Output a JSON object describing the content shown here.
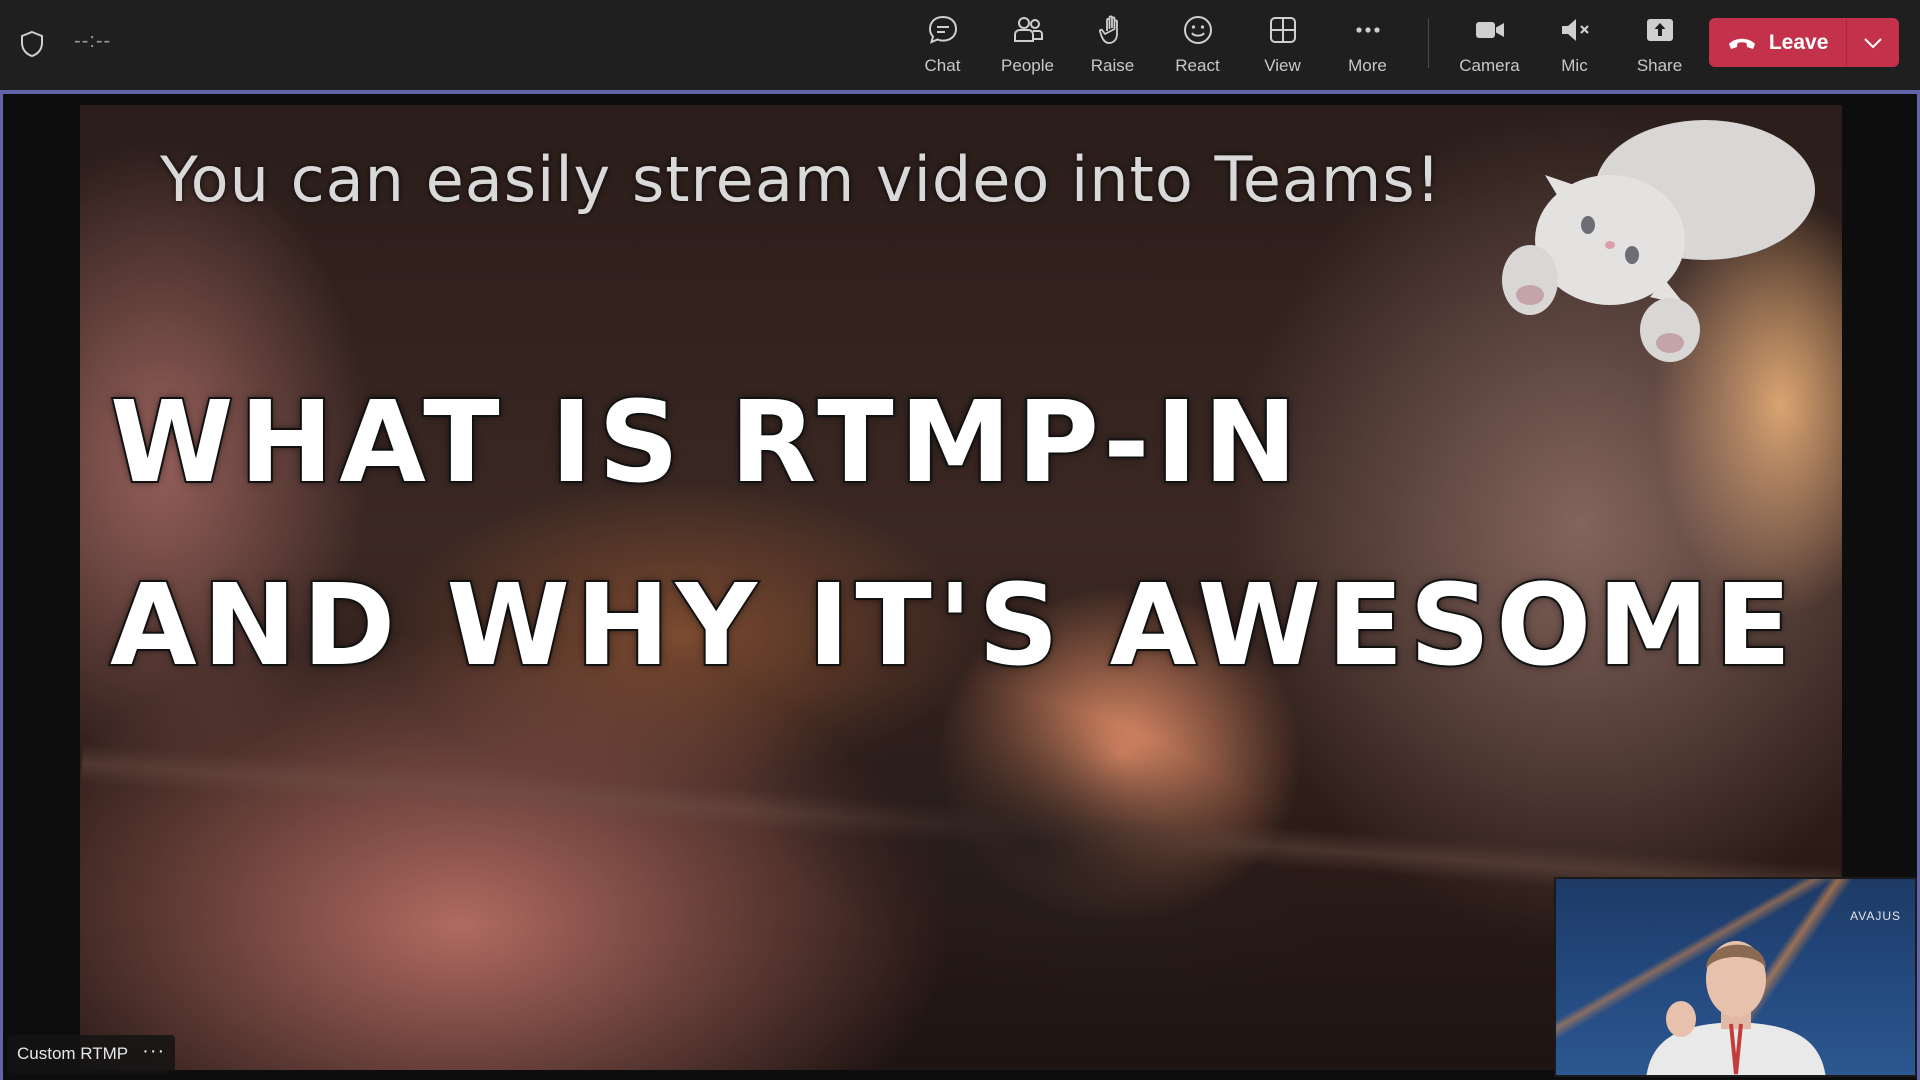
{
  "topbar": {
    "timer": "--:--",
    "tools": [
      {
        "label": "Chat",
        "icon": "chat-icon"
      },
      {
        "label": "People",
        "icon": "people-icon"
      },
      {
        "label": "Raise",
        "icon": "hand-icon"
      },
      {
        "label": "React",
        "icon": "smiley-icon"
      },
      {
        "label": "View",
        "icon": "grid-icon"
      },
      {
        "label": "More",
        "icon": "ellipsis-icon"
      },
      {
        "label": "Camera",
        "icon": "camera-icon"
      },
      {
        "label": "Mic",
        "icon": "mic-muted-icon"
      },
      {
        "label": "Share",
        "icon": "share-icon"
      }
    ],
    "leave_label": "Leave"
  },
  "stage": {
    "caption": "You can easily stream video into Teams!",
    "headline_line1": "WHAT IS RTMP-IN",
    "headline_line2": "AND WHY IT'S AWESOME"
  },
  "nametag": {
    "name": "Custom RTMP",
    "more": "···"
  },
  "selfview": {
    "logo_text": "AVAJUS"
  },
  "colors": {
    "accent": "#6264a7",
    "leave": "#c4314b",
    "topbar_bg": "#1f1f1f"
  }
}
